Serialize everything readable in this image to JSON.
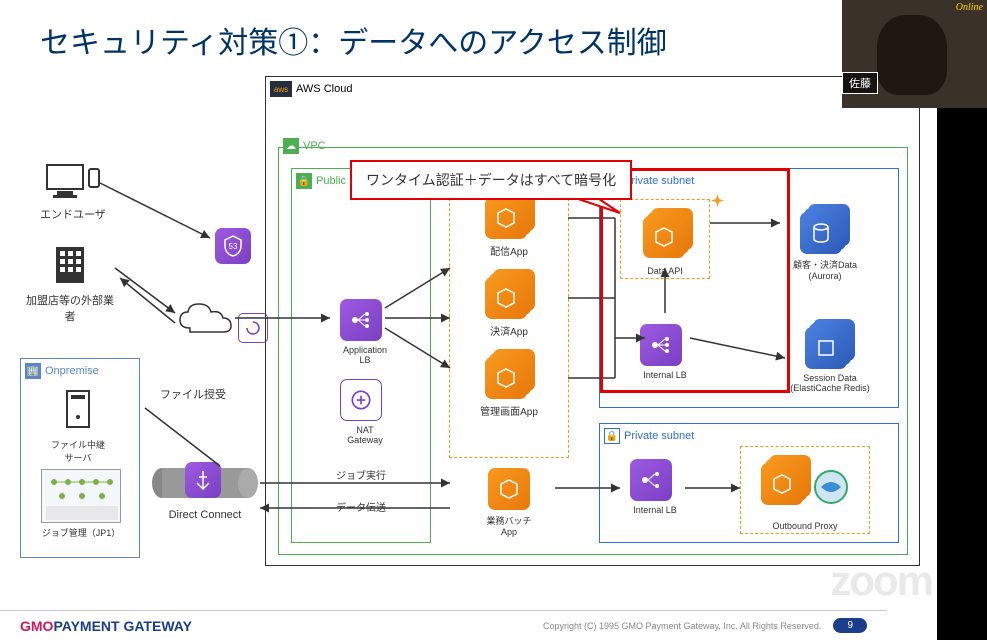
{
  "title": "セキュリティ対策①：データへのアクセス制御",
  "callout": "ワンタイム認証＋データはすべて暗号化",
  "regions": {
    "aws": "AWS Cloud",
    "vpc": "VPC",
    "public": "Public",
    "private1": "Private subnet",
    "private2": "Private subnet",
    "onprem": "Onpremise"
  },
  "external": {
    "enduser": "エンドユーザ",
    "merchant": "加盟店等の外部業者",
    "file_receive": "ファイル授受",
    "dc": "Direct Connect",
    "file_relay": "ファイル中継\nサーバ",
    "jp1": "ジョブ管理（JP1）"
  },
  "apps": {
    "alb": "Application LB",
    "nat": "NAT Gateway",
    "haishin": "配信App",
    "kessai": "決済App",
    "kanri": "管理画面App",
    "batch": "業務バッチApp",
    "data_api": "Data API",
    "ilb1": "Internal LB",
    "ilb2": "Internal LB",
    "proxy": "Outbound Proxy",
    "aurora": "顧客・決済Data\n(Aurora)",
    "redis": "Session Data\n(ElastiCache Redis)"
  },
  "flows": {
    "job_exec": "ジョブ実行",
    "data_trans": "データ伝送"
  },
  "footer": {
    "company": "PAYMENT GATEWAY",
    "g": "GMO",
    "copyright": "Copyright (C) 1995 GMO Payment Gateway, Inc. All Rights Reserved.",
    "page": "9"
  },
  "webcam": {
    "name": "佐藤",
    "badge": "Online"
  },
  "zoom_mark": "zoom"
}
